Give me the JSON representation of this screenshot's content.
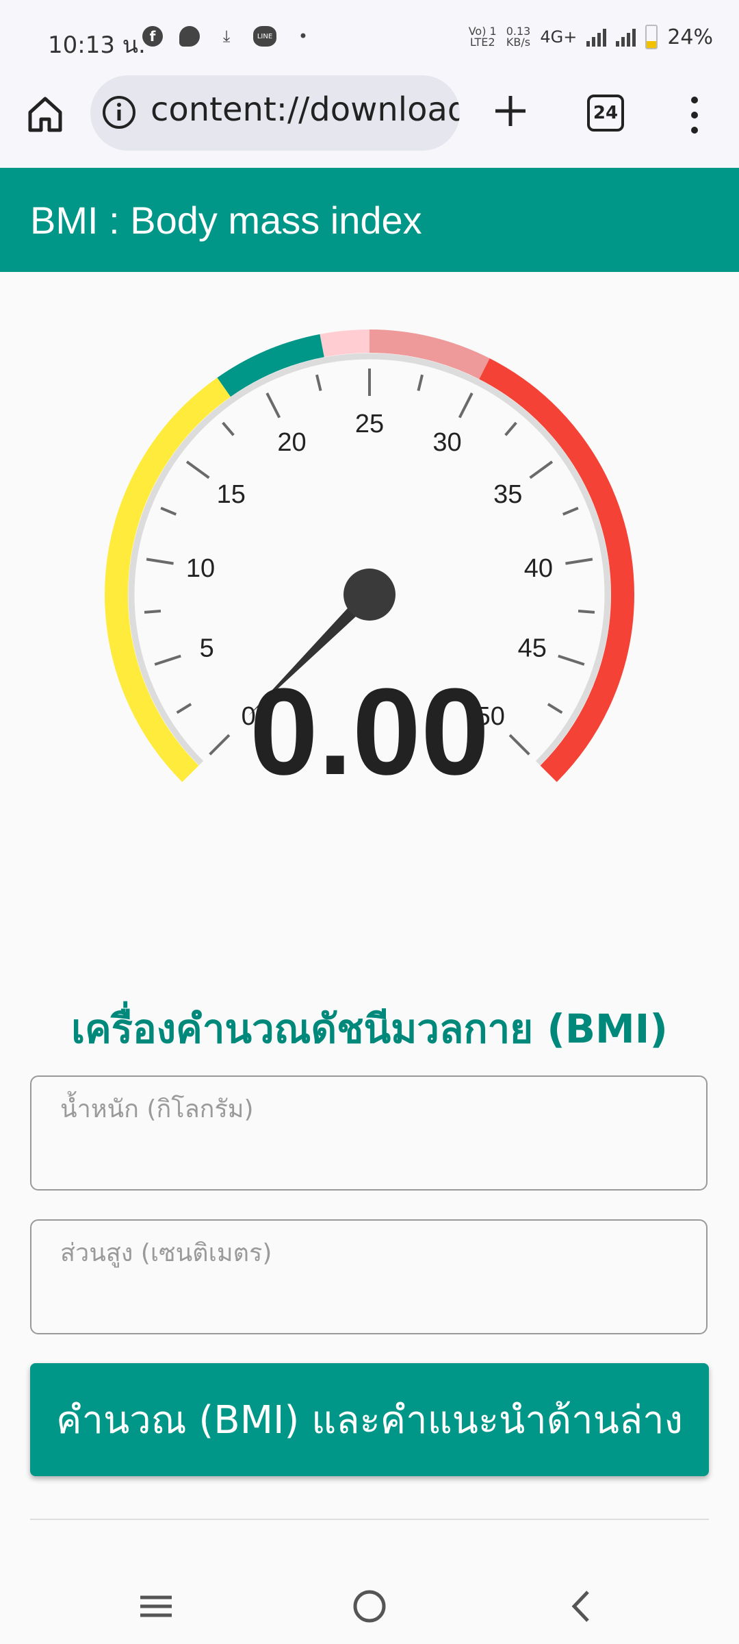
{
  "status_bar": {
    "time": "10:13 น.",
    "network_top": "Vo) 1",
    "network_bottom": "LTE2",
    "speed_top": "0.13",
    "speed_bottom": "KB/s",
    "network_type": "4G+",
    "battery": "24%"
  },
  "browser": {
    "url": "content://download",
    "tab_count": "24"
  },
  "header": {
    "title": "BMI : Body mass index"
  },
  "gauge": {
    "value": "0.00",
    "min": 0,
    "max": 50,
    "ticks": [
      "0",
      "5",
      "10",
      "15",
      "20",
      "25",
      "30",
      "35",
      "40",
      "45",
      "50"
    ],
    "needle_value": 0,
    "zones": [
      {
        "from": 0,
        "to": 18.5,
        "color": "#ffeb3b"
      },
      {
        "from": 18.5,
        "to": 23,
        "color": "#009688"
      },
      {
        "from": 23,
        "to": 25,
        "color": "#ffcdd2"
      },
      {
        "from": 25,
        "to": 30,
        "color": "#ef9a9a"
      },
      {
        "from": 30,
        "to": 50,
        "color": "#f44336"
      }
    ]
  },
  "calculator": {
    "title": "เครื่องคำนวณดัชนีมวลกาย (BMI)",
    "weight_label": "น้ำหนัก (กิโลกรัม)",
    "height_label": "ส่วนสูง (เซนติเมตร)",
    "button_label": "คำนวณ (BMI) และคำแนะนำด้านล่าง"
  },
  "colors": {
    "accent": "#009688"
  }
}
